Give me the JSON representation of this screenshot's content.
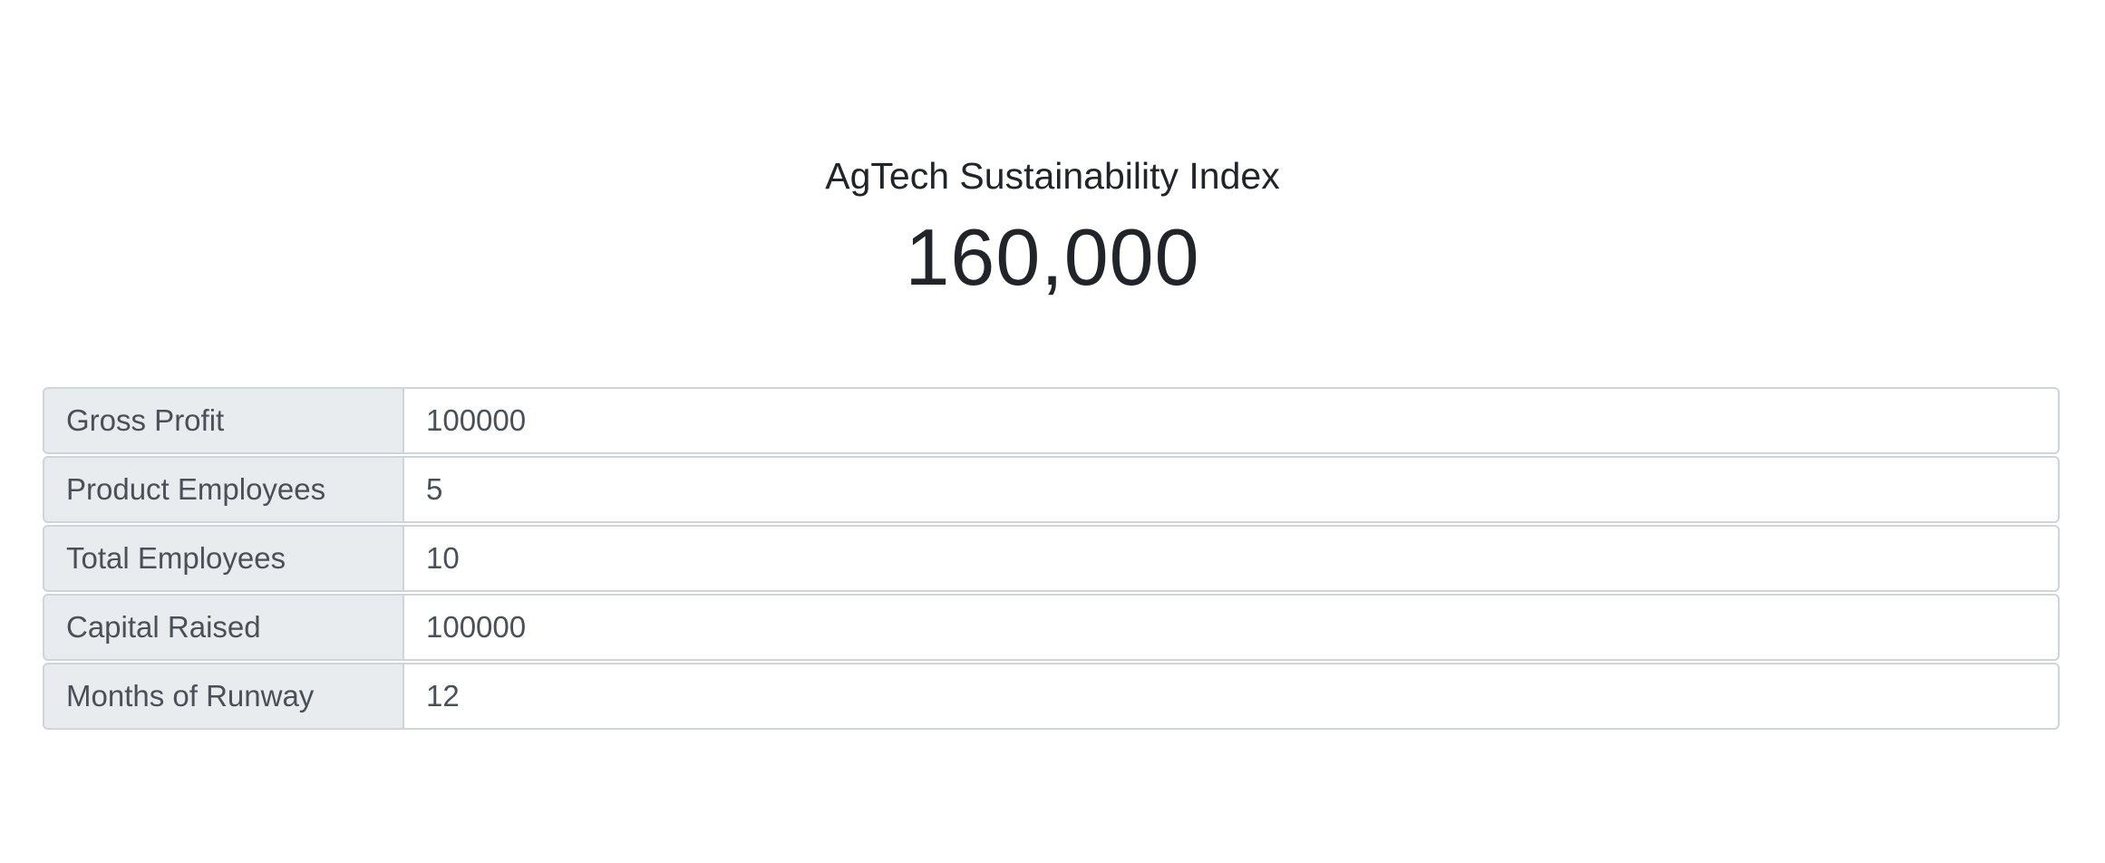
{
  "index": {
    "title": "AgTech Sustainability Index",
    "value": "160,000"
  },
  "fields": [
    {
      "label": "Gross Profit",
      "value": "100000"
    },
    {
      "label": "Product Employees",
      "value": "5"
    },
    {
      "label": "Total Employees",
      "value": "10"
    },
    {
      "label": "Capital Raised",
      "value": "100000"
    },
    {
      "label": "Months of Runway",
      "value": "12"
    }
  ]
}
